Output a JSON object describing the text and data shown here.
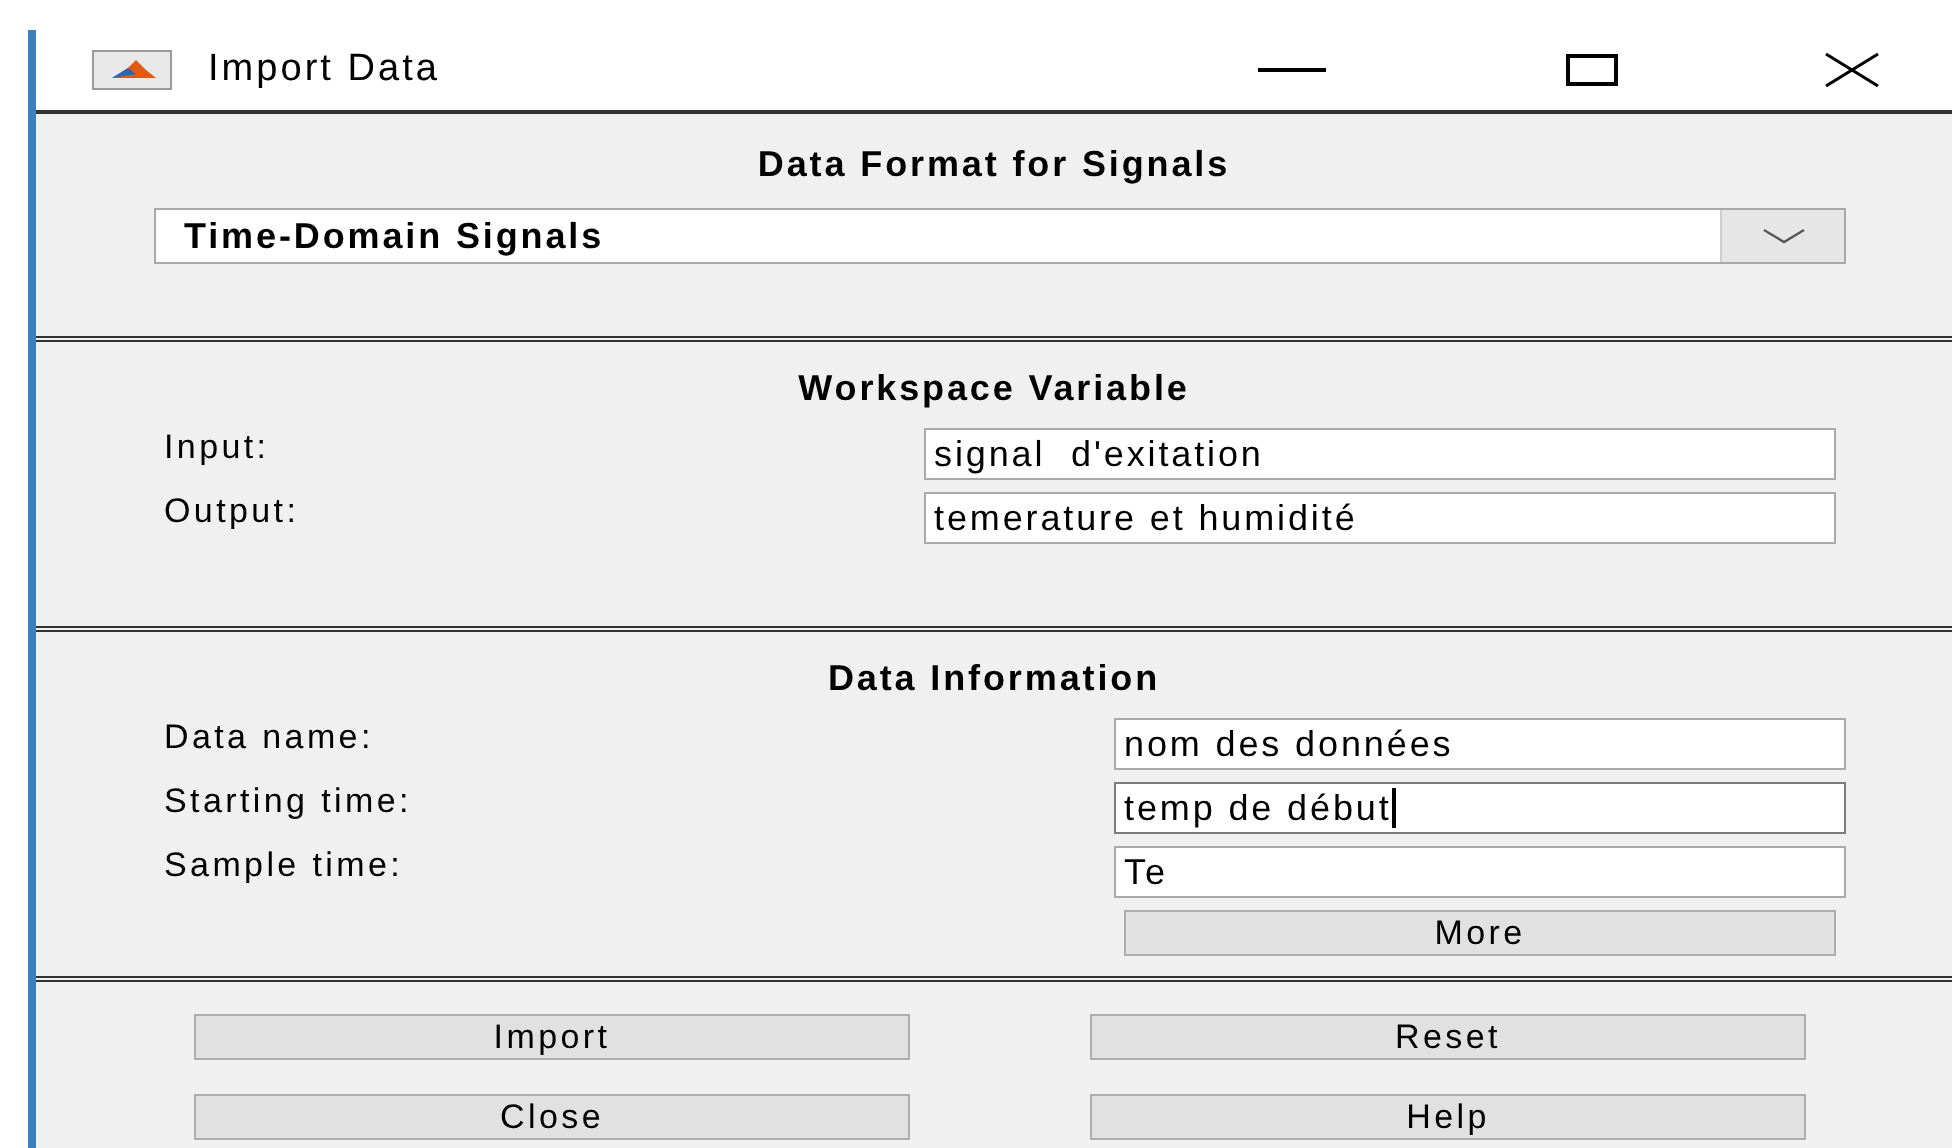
{
  "window": {
    "title": "Import Data"
  },
  "format_section": {
    "title": "Data Format for Signals",
    "dropdown": {
      "value": "Time-Domain Signals"
    }
  },
  "workspace_section": {
    "title": "Workspace Variable",
    "fields": [
      {
        "label": "Input:",
        "value": "signal  d'exitation",
        "focused": false
      },
      {
        "label": "Output:",
        "value": "temerature et humidité",
        "focused": false
      }
    ]
  },
  "info_section": {
    "title": "Data Information",
    "fields": [
      {
        "label": "Data name:",
        "value": "nom des données",
        "focused": false
      },
      {
        "label": "Starting time:",
        "value": "temp de début",
        "focused": true
      },
      {
        "label": "Sample time:",
        "value": "Te",
        "focused": false
      }
    ],
    "more_button": "More"
  },
  "buttons": [
    "Import",
    "Reset",
    "Close",
    "Help"
  ]
}
